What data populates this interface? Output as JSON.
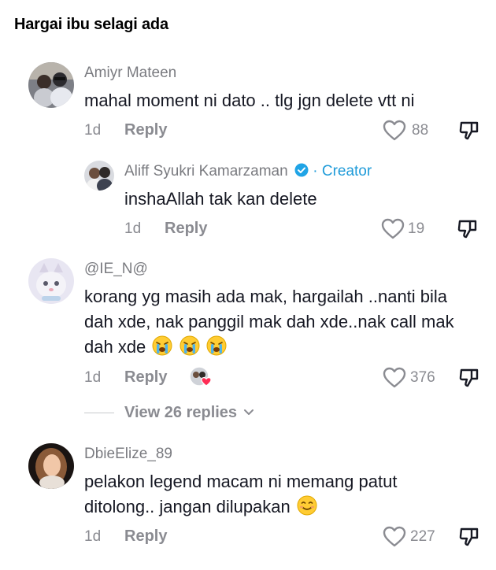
{
  "video_title": "Hargai ibu selagi ada",
  "comments": [
    {
      "username": "Amiyr Mateen",
      "text": "mahal moment ni dato .. tlg jgn delete vtt ni",
      "age": "1d",
      "reply_label": "Reply",
      "likes": "88"
    },
    {
      "username": "Aliff Syukri Kamarzaman",
      "creator_sep": "·",
      "creator_label": "Creator",
      "text": "inshaAllah tak kan delete",
      "age": "1d",
      "reply_label": "Reply",
      "likes": "19"
    },
    {
      "username": "@IE_N@",
      "text": "korang yg masih ada mak, hargailah ..nanti bila dah xde, nak panggil mak dah xde..nak call mak dah xde",
      "age": "1d",
      "reply_label": "Reply",
      "likes": "376",
      "view_replies": "View 26 replies"
    },
    {
      "username": "DbieElize_89",
      "text": "pelakon legend macam ni memang patut ditolong.. jangan dilupakan",
      "age": "1d",
      "reply_label": "Reply",
      "likes": "227"
    }
  ],
  "colors": {
    "accent_verified": "#20a4e6",
    "muted": "#8a8b91",
    "text": "#161823"
  },
  "icons": [
    "heart-outline-icon",
    "dislike-icon",
    "verified-badge-icon",
    "chevron-down-icon",
    "crying-emoji-icon",
    "smile-emoji-icon",
    "creator-liked-badge-icon"
  ]
}
